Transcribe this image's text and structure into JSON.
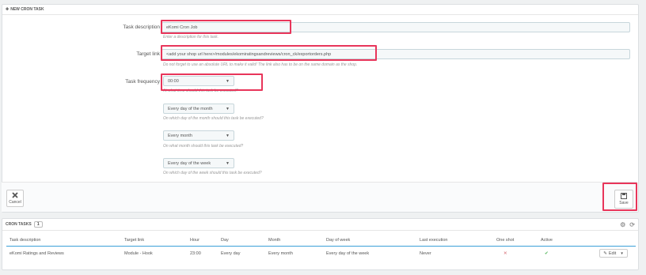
{
  "form_panel": {
    "title": "New cron task",
    "task_description": {
      "label": "Task description",
      "value": "eKomi Cron Job",
      "help": "Enter a description for this task."
    },
    "target_link": {
      "label": "Target link",
      "value": "<add your shop url here>/modules/ekomiratingsandreviews/cron_ck/exportorders.php",
      "help": "Do not forget to use an absolute URL to make it valid! The link also has to be on the same domain as the shop."
    },
    "task_frequency": {
      "label": "Task frequency",
      "value": "00:00",
      "help": "At what time should this task be executed?"
    },
    "day_of_month": {
      "value": "Every day of the month",
      "help": "On which day of the month should this task be executed?"
    },
    "month": {
      "value": "Every month",
      "help": "On what month should this task be executed?"
    },
    "day_of_week": {
      "value": "Every day of the week",
      "help": "On which day of the week should this task be executed?"
    },
    "cancel_label": "Cancel",
    "save_label": "Save"
  },
  "cron_panel": {
    "title": "Cron tasks",
    "count": "1",
    "headers": [
      "Task description",
      "Target link",
      "Hour",
      "Day",
      "Month",
      "Day of week",
      "Last execution",
      "One shot",
      "Active"
    ],
    "row": [
      "eKomi Ratings and Reviews",
      "Module - Hook",
      "23:00",
      "Every day",
      "Every month",
      "Every day of the week",
      "Never"
    ],
    "edit_label": "Edit"
  },
  "colors": {
    "highlight": "#e8355a",
    "success": "#72c279",
    "danger": "#e08f95"
  }
}
